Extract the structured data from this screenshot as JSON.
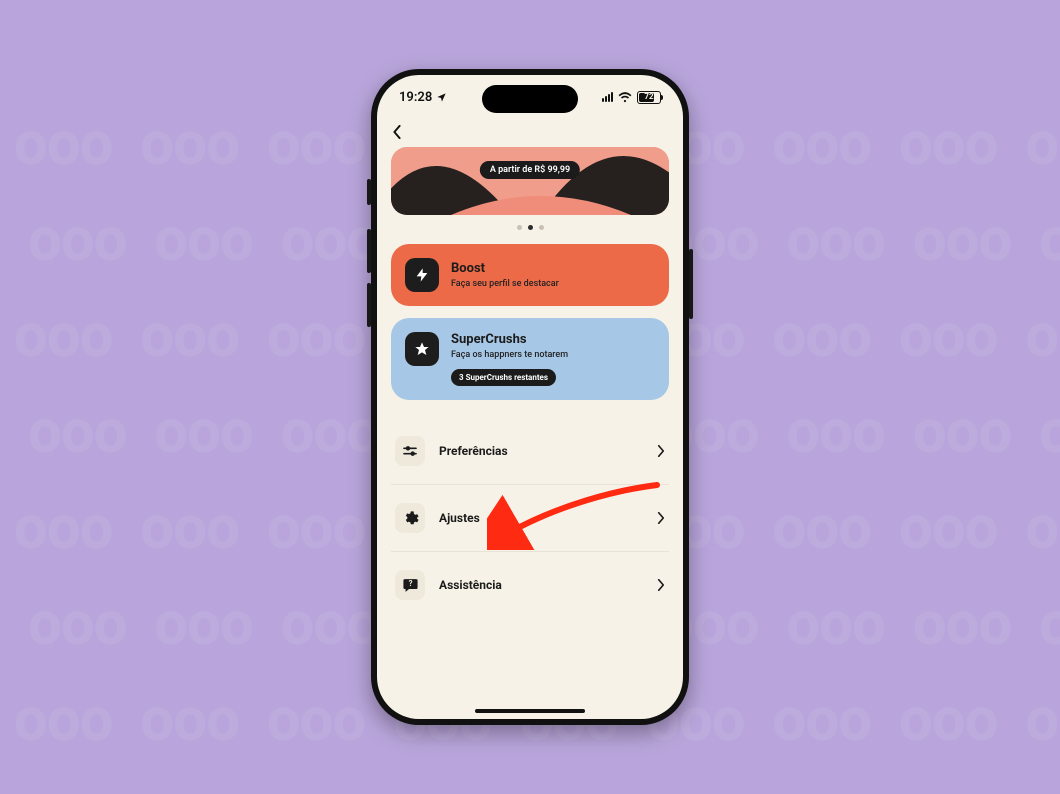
{
  "status_bar": {
    "time": "19:28",
    "battery_pct": "72"
  },
  "promo": {
    "price_label": "A partir de R$ 99,99"
  },
  "boost": {
    "title": "Boost",
    "subtitle": "Faça seu perfil se destacar"
  },
  "supercrush": {
    "title": "SuperCrushs",
    "subtitle": "Faça os happners te notarem",
    "badge": "3 SuperCrushs restantes"
  },
  "menu": {
    "preferences": "Preferências",
    "settings": "Ajustes",
    "support": "Assistência"
  }
}
